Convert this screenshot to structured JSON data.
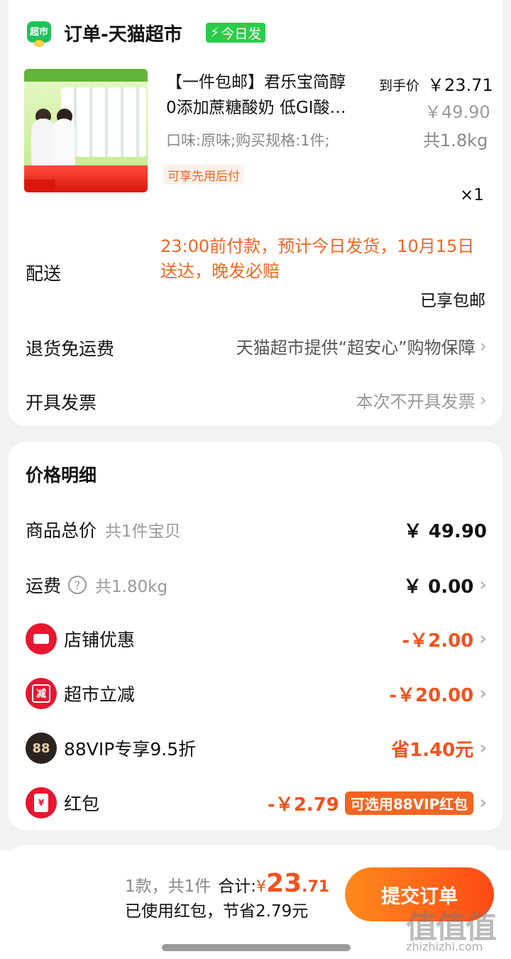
{
  "shop": {
    "logo_text": "超市",
    "name": "订单-天猫超市",
    "badge": "今日发",
    "badge_icon": "lightning-icon"
  },
  "product": {
    "image_desc_icon": "product-thumbnail",
    "title_line1": "【一件包邮】君乐宝简醇",
    "title_line2": "0添加蔗糖酸奶 低GI酸…",
    "price_label": "到手价",
    "price_now": "￥23.71",
    "price_original": "￥49.90",
    "spec": "口味:原味;购买规格:1件;",
    "weight": "共1.8kg",
    "pay_later": "可享先用后付",
    "quantity": "×1"
  },
  "delivery": {
    "label": "配送",
    "text": "23:00前付款，预计今日发货，10月15日送达，晚发必赔",
    "free_shipping": "已享包邮"
  },
  "return_shipping": {
    "label": "退货免运费",
    "value": "天猫超市提供“超安心”购物保障"
  },
  "invoice": {
    "label": "开具发票",
    "value": "本次不开具发票"
  },
  "price_detail": {
    "title": "价格明细",
    "goods_total_label": "商品总价",
    "goods_total_sub": "共1件宝贝",
    "goods_total_value": "￥ 49.90",
    "shipping_label": "运费",
    "shipping_sub": "共1.80kg",
    "shipping_value": "￥ 0.00",
    "shop_discount_label": "店铺优惠",
    "shop_discount_value": "-￥2.00",
    "market_discount_label": "超市立减",
    "market_discount_icon_text": "减",
    "market_discount_value": "-￥20.00",
    "vip_label": "88VIP专享9.5折",
    "vip_icon_text": "88",
    "vip_value": "省1.40元",
    "redpacket_label": "红包",
    "redpacket_icon_text": "¥",
    "redpacket_value": "-￥2.79",
    "redpacket_badge": "可选用88VIP红包"
  },
  "footer": {
    "count_text": "1款，共1件",
    "total_label": "合计:",
    "total_currency": "¥",
    "total_int": "23",
    "total_dec": ".71",
    "savings_text": "已使用红包，节省2.79元",
    "submit_label": "提交订单"
  },
  "watermark": {
    "text": "值值值",
    "url": "zhizhizhi.com"
  },
  "colors": {
    "accent_orange": "#f26522",
    "discount_red": "#f2511b",
    "badge_green": "#2bcc4a"
  }
}
